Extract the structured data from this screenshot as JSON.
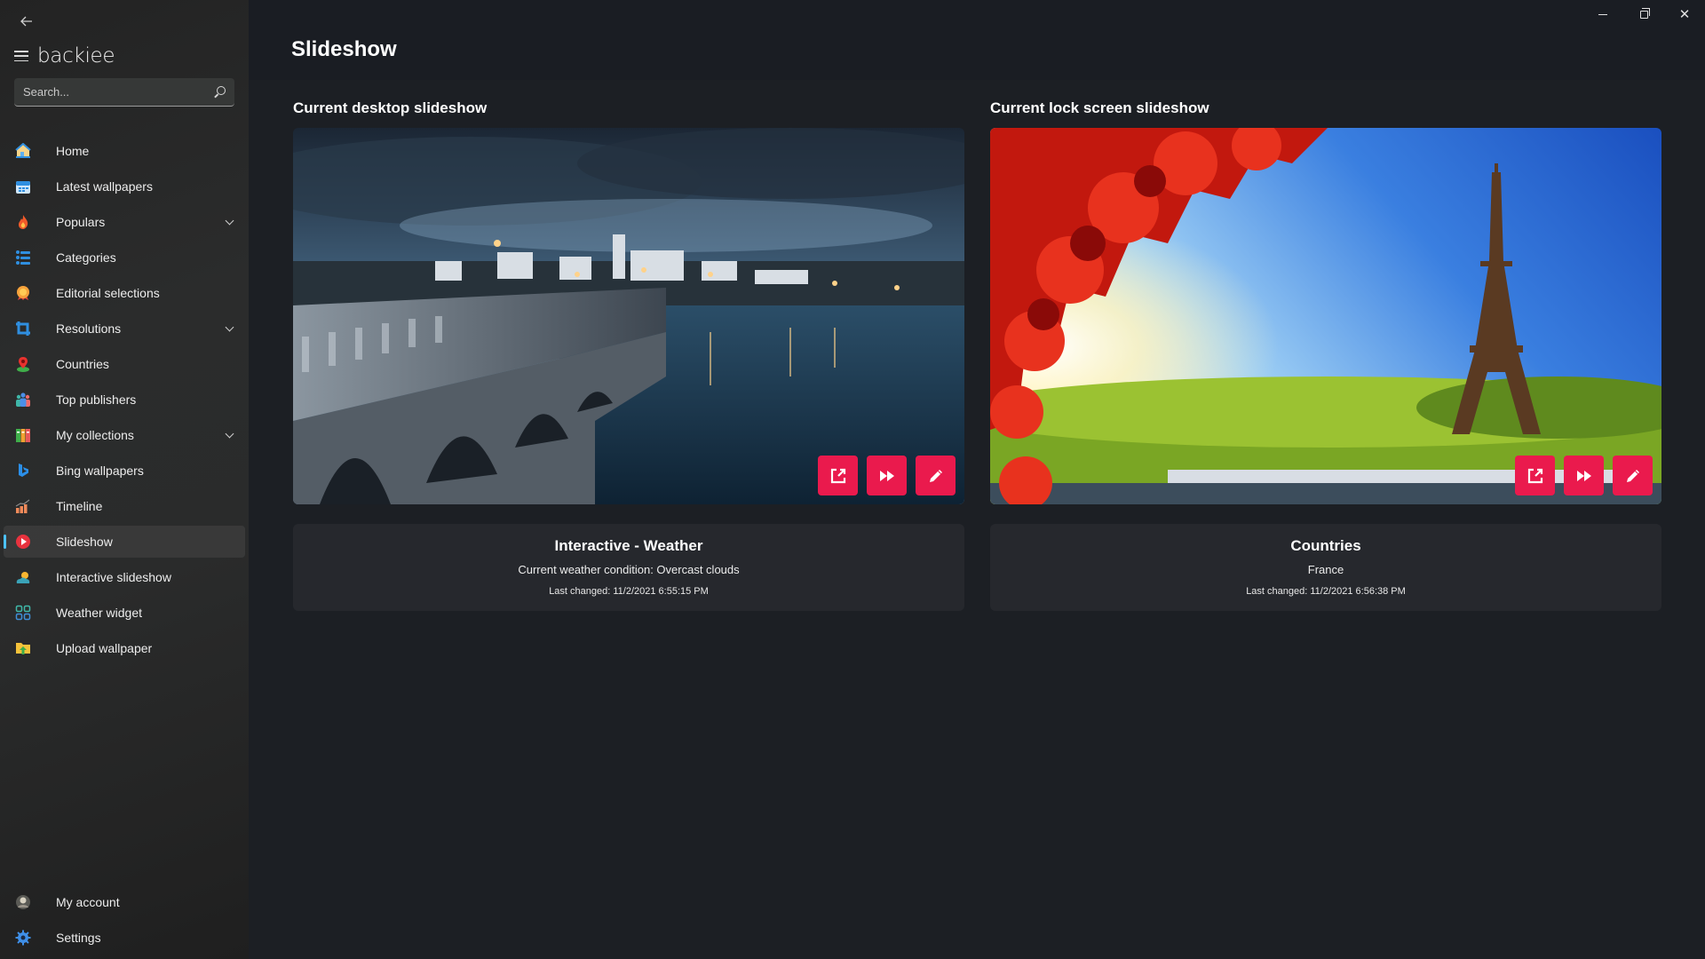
{
  "app": {
    "brand": "backiee",
    "back_icon": "arrow-left-icon",
    "menu_icon": "hamburger-icon"
  },
  "search": {
    "placeholder": "Search...",
    "value": "",
    "icon": "search-icon"
  },
  "sidebar": {
    "items": [
      {
        "label": "Home",
        "icon": "home-icon",
        "expandable": false,
        "active": false
      },
      {
        "label": "Latest wallpapers",
        "icon": "calendar-icon",
        "expandable": false,
        "active": false
      },
      {
        "label": "Populars",
        "icon": "fire-icon",
        "expandable": true,
        "active": false
      },
      {
        "label": "Categories",
        "icon": "list-icon",
        "expandable": false,
        "active": false
      },
      {
        "label": "Editorial selections",
        "icon": "award-icon",
        "expandable": false,
        "active": false
      },
      {
        "label": "Resolutions",
        "icon": "crop-icon",
        "expandable": true,
        "active": false
      },
      {
        "label": "Countries",
        "icon": "map-pin-icon",
        "expandable": false,
        "active": false
      },
      {
        "label": "Top publishers",
        "icon": "people-icon",
        "expandable": false,
        "active": false
      },
      {
        "label": "My collections",
        "icon": "binders-icon",
        "expandable": true,
        "active": false
      },
      {
        "label": "Bing wallpapers",
        "icon": "bing-icon",
        "expandable": false,
        "active": false
      },
      {
        "label": "Timeline",
        "icon": "bar-chart-icon",
        "expandable": false,
        "active": false
      },
      {
        "label": "Slideshow",
        "icon": "play-icon",
        "expandable": false,
        "active": true
      },
      {
        "label": "Interactive slideshow",
        "icon": "weather-icon",
        "expandable": false,
        "active": false
      },
      {
        "label": "Weather widget",
        "icon": "grid-icon",
        "expandable": false,
        "active": false
      },
      {
        "label": "Upload wallpaper",
        "icon": "folder-upload-icon",
        "expandable": false,
        "active": false
      }
    ],
    "bottom_items": [
      {
        "label": "My account",
        "icon": "avatar-icon"
      },
      {
        "label": "Settings",
        "icon": "gear-icon"
      }
    ]
  },
  "window_controls": {
    "minimize": "minimize-icon",
    "maximize": "restore-icon",
    "close": "close-icon",
    "close_glyph": "✕"
  },
  "page": {
    "title": "Slideshow"
  },
  "panels": [
    {
      "heading": "Current desktop slideshow",
      "image_description": "Night view of a stone arch bridge over a river with a lit town and cloudy sky",
      "actions": [
        "open-external",
        "next",
        "edit"
      ],
      "card": {
        "title": "Interactive - Weather",
        "subtitle": "Current weather condition: Overcast clouds",
        "last_changed": "Last changed: 11/2/2021 6:55:15 PM"
      }
    },
    {
      "heading": "Current lock screen slideshow",
      "image_description": "Eiffel Tower with red autumn leaves and blue sky over the Seine",
      "actions": [
        "open-external",
        "next",
        "edit"
      ],
      "card": {
        "title": "Countries",
        "subtitle": "France",
        "last_changed": "Last changed: 11/2/2021 6:56:38 PM"
      }
    }
  ],
  "colors": {
    "accent": "#ea1a4d",
    "active_indicator": "#4cc2ff",
    "background": "#1c1f24",
    "card": "#26282d"
  }
}
